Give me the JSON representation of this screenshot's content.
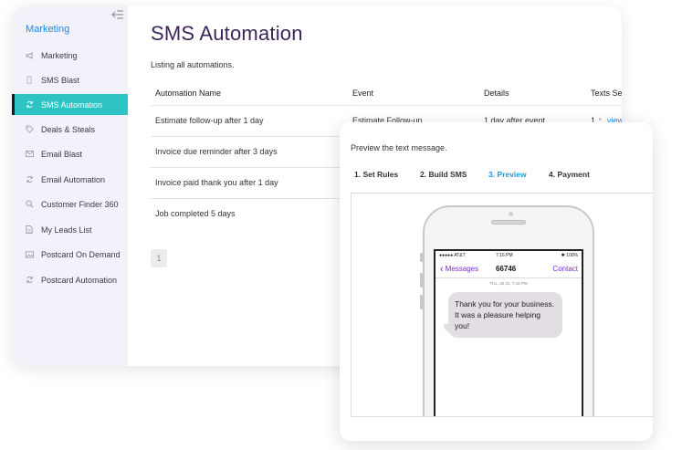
{
  "sidebar": {
    "title": "Marketing",
    "items": [
      {
        "label": "Marketing",
        "icon": "megaphone-icon"
      },
      {
        "label": "SMS Blast",
        "icon": "phone-icon"
      },
      {
        "label": "SMS Automation",
        "icon": "sync-icon",
        "active": true
      },
      {
        "label": "Deals & Steals",
        "icon": "tag-icon"
      },
      {
        "label": "Email Blast",
        "icon": "envelope-icon"
      },
      {
        "label": "Email Automation",
        "icon": "sync-icon"
      },
      {
        "label": "Customer Finder 360",
        "icon": "search-icon"
      },
      {
        "label": "My Leads List",
        "icon": "document-icon"
      },
      {
        "label": "Postcard On Demand",
        "icon": "image-icon"
      },
      {
        "label": "Postcard Automation",
        "icon": "sync-icon"
      }
    ]
  },
  "main": {
    "title": "SMS Automation",
    "subtitle": "Listing all automations.",
    "columns": [
      "Automation Name",
      "Event",
      "Details",
      "Texts Se"
    ],
    "rows": [
      {
        "name": "Estimate follow-up after 1 day",
        "event": "Estimate Follow-up",
        "details": "1 day after event",
        "texts": "1",
        "sep": "•",
        "link": "view"
      },
      {
        "name": "Invoice due reminder after 3 days"
      },
      {
        "name": "Invoice paid thank you after 1 day"
      },
      {
        "name": "Job completed 5 days"
      }
    ],
    "page": "1"
  },
  "preview": {
    "label": "Preview the text message.",
    "steps": [
      "1. Set Rules",
      "2. Build SMS",
      "3. Preview",
      "4. Payment"
    ],
    "active_step": 2,
    "phone": {
      "carrier": "●●●●● AT&T",
      "time": "7:16 PM",
      "battery": "✱ 100%",
      "back_label": "Messages",
      "number": "66746",
      "contact_label": "Contact",
      "message_time": "Thu, Jul 31, 7:16 PM",
      "message": "Thank you for your business. It was a pleasure helping you!"
    }
  },
  "colors": {
    "accent": "#2ec4c4",
    "title": "#3b2559",
    "link": "#1e88e5",
    "step_active": "#1e9bd7",
    "imessage_purple": "#7b2fd1"
  }
}
